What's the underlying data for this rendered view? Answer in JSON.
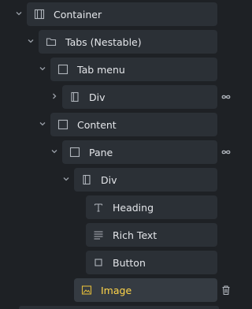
{
  "tree": {
    "nodes": [
      {
        "label": "Container",
        "icon": "container-icon"
      },
      {
        "label": "Tabs (Nestable)",
        "icon": "folder-icon"
      },
      {
        "label": "Tab menu",
        "icon": "square-icon"
      },
      {
        "label": "Div",
        "icon": "div-icon"
      },
      {
        "label": "Content",
        "icon": "square-icon"
      },
      {
        "label": "Pane",
        "icon": "square-icon"
      },
      {
        "label": "Div",
        "icon": "div-icon"
      },
      {
        "label": "Heading",
        "icon": "heading-icon"
      },
      {
        "label": "Rich Text",
        "icon": "rich-text-icon"
      },
      {
        "label": "Button",
        "icon": "button-icon"
      },
      {
        "label": "Image",
        "icon": "image-icon"
      }
    ]
  },
  "colors": {
    "background": "#1e2125",
    "row": "#2b3036",
    "selected_row": "#353b42",
    "text": "#e4e6ea",
    "selected_text": "#ffd54a",
    "icon": "#9aa0a8"
  }
}
